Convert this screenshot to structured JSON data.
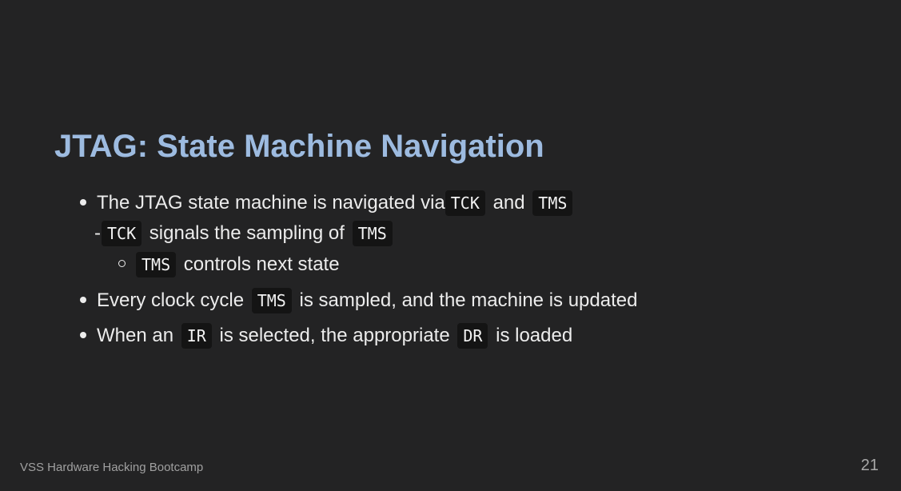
{
  "slide": {
    "title": "JTAG: State Machine Navigation",
    "bullets": {
      "b1": {
        "text_1": "The JTAG state machine is navigated via",
        "code_1": "TCK",
        "text_2": "and",
        "code_2": "TMS"
      },
      "sub1": {
        "dash": "-",
        "code_1": "TCK",
        "text_1": "signals the sampling of",
        "code_2": "TMS"
      },
      "sub2": {
        "code_1": "TMS",
        "text_1": "controls next state"
      },
      "b2": {
        "text_1": "Every clock cycle",
        "code_1": "TMS",
        "text_2": "is sampled, and the machine is updated"
      },
      "b3": {
        "text_1": "When an",
        "code_1": "IR",
        "text_2": "is selected, the appropriate",
        "code_2": "DR",
        "text_3": "is loaded"
      }
    },
    "footer": "VSS Hardware Hacking Bootcamp",
    "page_number": "21"
  },
  "colors": {
    "background": "#232324",
    "title": "#9dbbe0",
    "text": "#ececec",
    "code_background": "#141414",
    "footer_text": "#a0a0a0"
  }
}
